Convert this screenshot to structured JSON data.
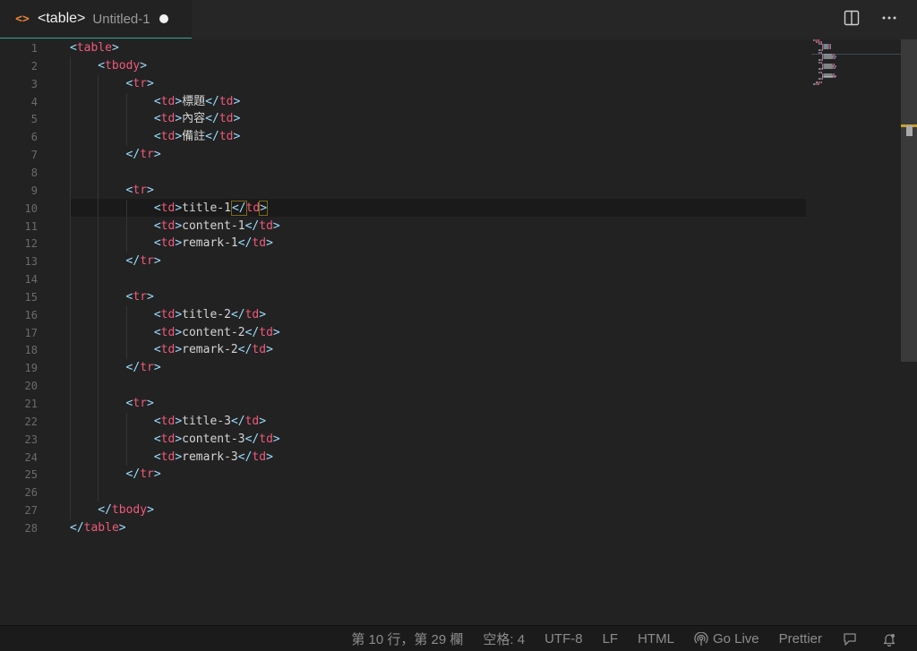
{
  "tab": {
    "icon": "html-code-icon",
    "icon_glyph": "<>",
    "title": "<table>",
    "description": "Untitled-1",
    "dirty": true
  },
  "actions": {
    "split_editor_icon": "split-editor-icon",
    "more_icon": "more-actions-icon"
  },
  "editor": {
    "line_numbers": [
      "1",
      "2",
      "3",
      "4",
      "5",
      "6",
      "7",
      "8",
      "9",
      "10",
      "11",
      "12",
      "13",
      "14",
      "15",
      "16",
      "17",
      "18",
      "19",
      "20",
      "21",
      "22",
      "23",
      "24",
      "25",
      "26",
      "27",
      "28"
    ],
    "lines": [
      {
        "indent": "",
        "tokens": [
          [
            "br",
            "<"
          ],
          [
            "tg",
            "table"
          ],
          [
            "br",
            ">"
          ]
        ]
      },
      {
        "indent": "    ",
        "tokens": [
          [
            "br",
            "<"
          ],
          [
            "tg",
            "tbody"
          ],
          [
            "br",
            ">"
          ]
        ]
      },
      {
        "indent": "        ",
        "tokens": [
          [
            "br",
            "<"
          ],
          [
            "tg",
            "tr"
          ],
          [
            "br",
            ">"
          ]
        ]
      },
      {
        "indent": "            ",
        "tokens": [
          [
            "br",
            "<"
          ],
          [
            "tg",
            "td"
          ],
          [
            "br",
            ">"
          ],
          [
            "tx",
            "標題"
          ],
          [
            "br",
            "</"
          ],
          [
            "tg",
            "td"
          ],
          [
            "br",
            ">"
          ]
        ]
      },
      {
        "indent": "            ",
        "tokens": [
          [
            "br",
            "<"
          ],
          [
            "tg",
            "td"
          ],
          [
            "br",
            ">"
          ],
          [
            "tx",
            "內容"
          ],
          [
            "br",
            "</"
          ],
          [
            "tg",
            "td"
          ],
          [
            "br",
            ">"
          ]
        ]
      },
      {
        "indent": "            ",
        "tokens": [
          [
            "br",
            "<"
          ],
          [
            "tg",
            "td"
          ],
          [
            "br",
            ">"
          ],
          [
            "tx",
            "備註"
          ],
          [
            "br",
            "</"
          ],
          [
            "tg",
            "td"
          ],
          [
            "br",
            ">"
          ]
        ]
      },
      {
        "indent": "        ",
        "tokens": [
          [
            "br",
            "</"
          ],
          [
            "tg",
            "tr"
          ],
          [
            "br",
            ">"
          ]
        ]
      },
      {
        "indent": "",
        "tokens": []
      },
      {
        "indent": "        ",
        "tokens": [
          [
            "br",
            "<"
          ],
          [
            "tg",
            "tr"
          ],
          [
            "br",
            ">"
          ]
        ]
      },
      {
        "indent": "            ",
        "tokens": [
          [
            "br",
            "<"
          ],
          [
            "tg",
            "td"
          ],
          [
            "br",
            ">"
          ],
          [
            "tx",
            "title-1"
          ],
          [
            "cursor",
            ""
          ],
          [
            "br",
            "</"
          ],
          [
            "tg",
            "td"
          ],
          [
            "br",
            ">"
          ]
        ]
      },
      {
        "indent": "            ",
        "tokens": [
          [
            "br",
            "<"
          ],
          [
            "tg",
            "td"
          ],
          [
            "br",
            ">"
          ],
          [
            "tx",
            "content-1"
          ],
          [
            "br",
            "</"
          ],
          [
            "tg",
            "td"
          ],
          [
            "br",
            ">"
          ]
        ]
      },
      {
        "indent": "            ",
        "tokens": [
          [
            "br",
            "<"
          ],
          [
            "tg",
            "td"
          ],
          [
            "br",
            ">"
          ],
          [
            "tx",
            "remark-1"
          ],
          [
            "br",
            "</"
          ],
          [
            "tg",
            "td"
          ],
          [
            "br",
            ">"
          ]
        ]
      },
      {
        "indent": "        ",
        "tokens": [
          [
            "br",
            "</"
          ],
          [
            "tg",
            "tr"
          ],
          [
            "br",
            ">"
          ]
        ]
      },
      {
        "indent": "",
        "tokens": []
      },
      {
        "indent": "        ",
        "tokens": [
          [
            "br",
            "<"
          ],
          [
            "tg",
            "tr"
          ],
          [
            "br",
            ">"
          ]
        ]
      },
      {
        "indent": "            ",
        "tokens": [
          [
            "br",
            "<"
          ],
          [
            "tg",
            "td"
          ],
          [
            "br",
            ">"
          ],
          [
            "tx",
            "title-2"
          ],
          [
            "br",
            "</"
          ],
          [
            "tg",
            "td"
          ],
          [
            "br",
            ">"
          ]
        ]
      },
      {
        "indent": "            ",
        "tokens": [
          [
            "br",
            "<"
          ],
          [
            "tg",
            "td"
          ],
          [
            "br",
            ">"
          ],
          [
            "tx",
            "content-2"
          ],
          [
            "br",
            "</"
          ],
          [
            "tg",
            "td"
          ],
          [
            "br",
            ">"
          ]
        ]
      },
      {
        "indent": "            ",
        "tokens": [
          [
            "br",
            "<"
          ],
          [
            "tg",
            "td"
          ],
          [
            "br",
            ">"
          ],
          [
            "tx",
            "remark-2"
          ],
          [
            "br",
            "</"
          ],
          [
            "tg",
            "td"
          ],
          [
            "br",
            ">"
          ]
        ]
      },
      {
        "indent": "        ",
        "tokens": [
          [
            "br",
            "</"
          ],
          [
            "tg",
            "tr"
          ],
          [
            "br",
            ">"
          ]
        ]
      },
      {
        "indent": "",
        "tokens": []
      },
      {
        "indent": "        ",
        "tokens": [
          [
            "br",
            "<"
          ],
          [
            "tg",
            "tr"
          ],
          [
            "br",
            ">"
          ]
        ]
      },
      {
        "indent": "            ",
        "tokens": [
          [
            "br",
            "<"
          ],
          [
            "tg",
            "td"
          ],
          [
            "br",
            ">"
          ],
          [
            "tx",
            "title-3"
          ],
          [
            "br",
            "</"
          ],
          [
            "tg",
            "td"
          ],
          [
            "br",
            ">"
          ]
        ]
      },
      {
        "indent": "            ",
        "tokens": [
          [
            "br",
            "<"
          ],
          [
            "tg",
            "td"
          ],
          [
            "br",
            ">"
          ],
          [
            "tx",
            "content-3"
          ],
          [
            "br",
            "</"
          ],
          [
            "tg",
            "td"
          ],
          [
            "br",
            ">"
          ]
        ]
      },
      {
        "indent": "            ",
        "tokens": [
          [
            "br",
            "<"
          ],
          [
            "tg",
            "td"
          ],
          [
            "br",
            ">"
          ],
          [
            "tx",
            "remark-3"
          ],
          [
            "br",
            "</"
          ],
          [
            "tg",
            "td"
          ],
          [
            "br",
            ">"
          ]
        ]
      },
      {
        "indent": "        ",
        "tokens": [
          [
            "br",
            "</"
          ],
          [
            "tg",
            "tr"
          ],
          [
            "br",
            ">"
          ]
        ]
      },
      {
        "indent": "",
        "tokens": []
      },
      {
        "indent": "    ",
        "tokens": [
          [
            "br",
            "</"
          ],
          [
            "tg",
            "tbody"
          ],
          [
            "br",
            ">"
          ]
        ]
      },
      {
        "indent": "",
        "tokens": [
          [
            "br",
            "</"
          ],
          [
            "tg",
            "table"
          ],
          [
            "br",
            ">"
          ]
        ]
      }
    ],
    "current_line": 10
  },
  "statusbar": {
    "position": "第 10 行，第 29 欄",
    "indent": "空格: 4",
    "encoding": "UTF-8",
    "eol": "LF",
    "language": "HTML",
    "go_live": "Go Live",
    "prettier": "Prettier",
    "feedback_icon": "feedback-icon",
    "bell_icon": "notification-bell-icon",
    "go_live_icon": "broadcast-icon"
  },
  "colors": {
    "tag": "#f0597a",
    "bracket": "#9cdcfe",
    "text": "#d4d4d4",
    "icon_orange": "#e8853a"
  }
}
